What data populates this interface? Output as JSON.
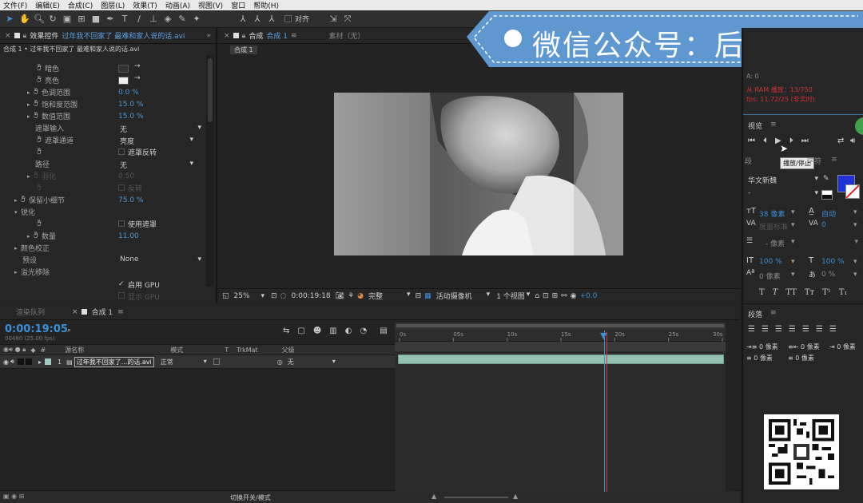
{
  "menu": [
    "文件(F)",
    "编辑(E)",
    "合成(C)",
    "图层(L)",
    "效果(T)",
    "动画(A)",
    "视图(V)",
    "窗口",
    "帮助(H)"
  ],
  "toolbar": {
    "align_label": "对齐"
  },
  "effects_panel": {
    "tab_title": "效果控件",
    "tab_subject": "过年我不回家了 最难和家人说的话.avi",
    "breadcrumb": "合成 1 • 过年我不回家了 最难和家人说的话.avi",
    "rows": [
      {
        "label": "暗色"
      },
      {
        "label": "亮色"
      },
      {
        "label": "色调范围",
        "value": "0.0 %"
      },
      {
        "label": "饱和度范围",
        "value": "15.0 %"
      },
      {
        "label": "数值范围",
        "value": "15.0 %"
      },
      {
        "label": "遮罩输入",
        "dropdown": "无"
      },
      {
        "label": "遮罩通道",
        "dropdown": "亮度"
      },
      {
        "label": "遮罩反转"
      },
      {
        "label": "路径",
        "dropdown": "无"
      },
      {
        "label": "羽化",
        "value": "0.50"
      },
      {
        "label": "反转"
      },
      {
        "label": "保留小细节",
        "value": "75.0 %"
      },
      {
        "label": "锐化"
      },
      {
        "label": "使用遮罩"
      },
      {
        "label": "数量",
        "value": "11.00"
      },
      {
        "label": "颜色校正"
      },
      {
        "label": "预设",
        "dropdown": "None"
      },
      {
        "label": "溢光移除"
      },
      {
        "label": "启用 GPU"
      },
      {
        "label": "显示 GPU"
      }
    ]
  },
  "comp_panel": {
    "tab_title": "合成",
    "tab_name": "合成 1",
    "material_tab": "素材（无）",
    "subtab": "合成 1",
    "zoom": "25%",
    "timecode": "0:00:19:18",
    "quality": "完整",
    "camera": "活动摄像机",
    "views": "1 个视图",
    "exposure": "+0.0"
  },
  "watermark": {
    "text": "微信公众号：后期菌"
  },
  "info_panel": {
    "line1": "A: 0",
    "line2": "从 RAM 播放：13/750",
    "line3": "fps: 11.72/25 (非实时)"
  },
  "preview_panel": {
    "title": "视览",
    "tooltip": "播放/停止"
  },
  "character_panel": {
    "tabs_left": "段",
    "tabs_mid": "字符",
    "font": "华文新魏",
    "style": "-",
    "size": "38 像素",
    "leading": "自动",
    "kerning": "度量标准",
    "tracking": "0",
    "stroke": "- 像素",
    "vscale": "100 %",
    "hscale": "100 %",
    "baseline": "0 像素",
    "tsume": "0 %",
    "swatch_fill": "#2132d6"
  },
  "paragraph_panel": {
    "title": "段落",
    "indent1": "0 像素",
    "indent2": "0 像素",
    "indent3": "0 像素",
    "space1": "0 像素",
    "space2": "0 像素"
  },
  "timeline_panel": {
    "render_tab": "渲染队列",
    "comp_tab": "合成 1",
    "timecode": "0:00:19:05",
    "frames": "00480 (25.00 fps)",
    "col_source": "源名称",
    "col_mode": "模式",
    "col_t": "T",
    "col_trkmat": "TrkMat",
    "col_parent": "父级",
    "layer_num": "1",
    "layer_name": "过年我不回家了...的话.avi",
    "layer_mode": "正常",
    "layer_parent": "无",
    "ruler": [
      "0s",
      "05s",
      "10s",
      "15s",
      "20s",
      "25s",
      "30s"
    ],
    "footer": "切换开关/模式"
  }
}
